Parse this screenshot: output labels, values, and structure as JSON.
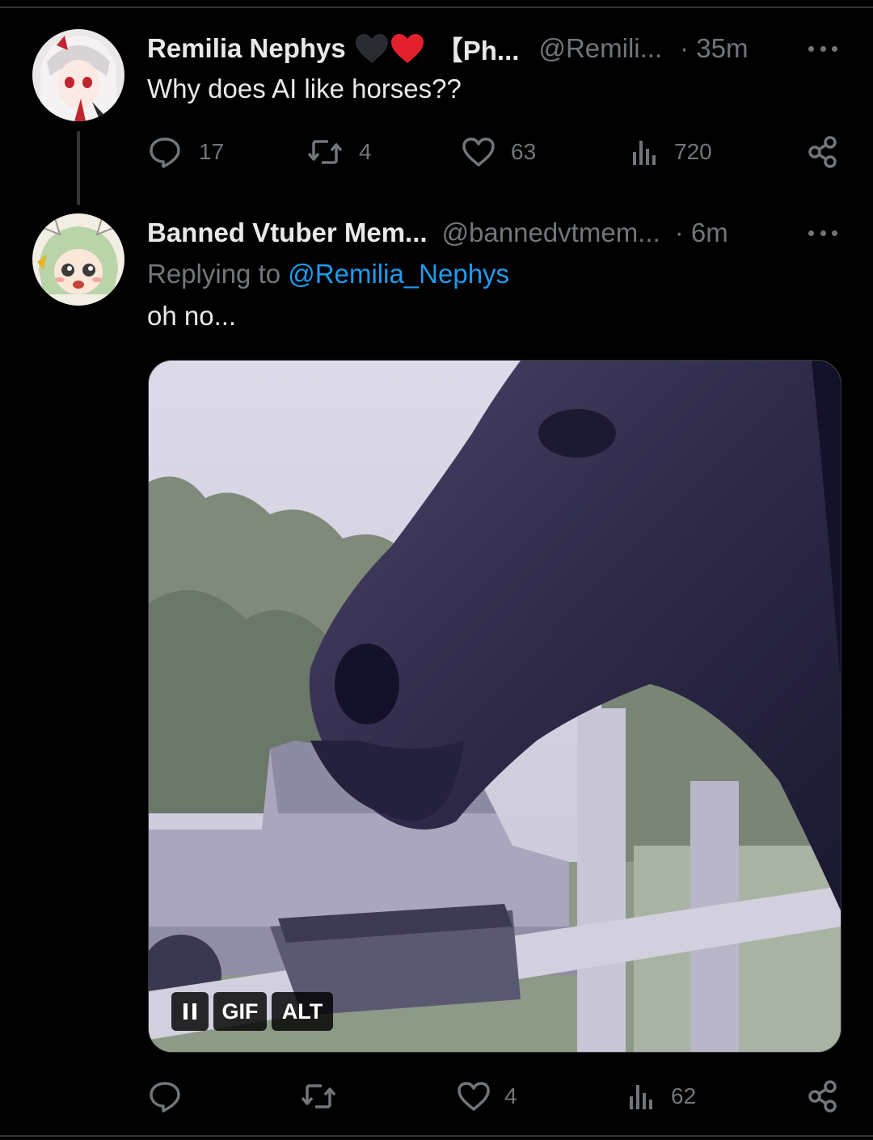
{
  "tweet1": {
    "name": "Remilia Nephys",
    "suffix": "【Ph...",
    "handle": "@Remili...",
    "time": "· 35m",
    "text": "Why does AI like horses??",
    "icons": [
      "black-heart-icon",
      "red-heart-icon"
    ],
    "colors": {
      "black_heart": "#292d32",
      "red_heart": "#e5202e"
    },
    "actions": {
      "replies": "17",
      "reposts": "4",
      "likes": "63",
      "views": "720"
    }
  },
  "tweet2": {
    "name": "Banned Vtuber Mem...",
    "handle": "@bannedvtmem...",
    "time": "· 6m",
    "replying_prefix": "Replying to",
    "replying_handle": "@Remilia_Nephys",
    "text": "oh no...",
    "media": {
      "type": "gif",
      "description_icon": "horse-gif",
      "controls": {
        "gif_label": "GIF",
        "alt_label": "ALT"
      }
    },
    "actions": {
      "replies": "",
      "reposts": "",
      "likes": "4",
      "views": "62"
    }
  },
  "colors": {
    "background": "#000000",
    "text": "#e7e9ea",
    "secondary": "#71767b",
    "link": "#1d9bf0",
    "divider": "#2f3336"
  }
}
